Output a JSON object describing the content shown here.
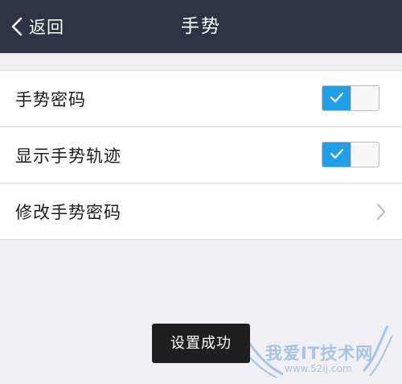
{
  "navbar": {
    "back_label": "返回",
    "title": "手势"
  },
  "settings": {
    "items": [
      {
        "label": "手势密码",
        "control": "toggle",
        "checked": true
      },
      {
        "label": "显示手势轨迹",
        "control": "toggle",
        "checked": true
      },
      {
        "label": "修改手势密码",
        "control": "chevron"
      }
    ]
  },
  "toast": {
    "message": "设置成功"
  },
  "watermark": {
    "text": "我爱IT技术网",
    "url": "www.52ij.com"
  },
  "colors": {
    "navbar_bg": "#2e3445",
    "toggle_on": "#1e9fe8",
    "page_bg": "#efeff4",
    "toast_bg": "#1f1f1f"
  },
  "icons": {
    "back": "chevron-left-icon",
    "check": "check-icon",
    "chevron": "chevron-right-icon"
  }
}
